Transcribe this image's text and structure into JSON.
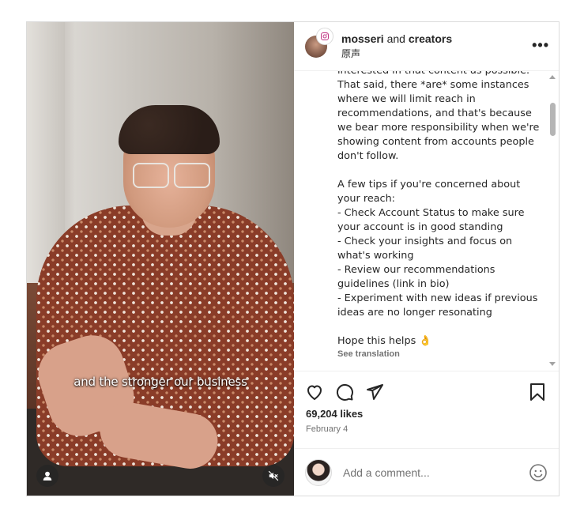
{
  "header": {
    "owner": "mosseri",
    "and": "and",
    "creators": "creators",
    "audio": "原声",
    "more_label": "•••"
  },
  "media": {
    "subtitle": "and the stronger our business",
    "user_icon": "user-icon",
    "mute_icon": "speaker-muted-icon"
  },
  "caption": {
    "text": "interested in that content as possible.\nThat said, there *are* some instances\nwhere we will limit reach in\nrecommendations, and that's because\nwe bear more responsibility when we're\nshowing content from accounts people\ndon't follow.\n\nA few tips if you're concerned about\nyour reach:\n- Check Account Status to make sure\nyour account is in good standing\n- Check your insights and focus on\nwhat's working\n- Review our recommendations\nguidelines (link in bio)\n- Experiment with new ideas if previous\nideas are no longer resonating\n\nHope this helps 👌",
    "see_translation": "See translation"
  },
  "actions": {
    "like_icon": "heart-icon",
    "comment_icon": "comment-bubble-icon",
    "share_icon": "paper-plane-icon",
    "save_icon": "bookmark-icon"
  },
  "likes": "69,204 likes",
  "date": "February 4",
  "comment": {
    "placeholder": "Add a comment...",
    "emoji_icon": "smiley-icon"
  },
  "colors": {
    "border": "#dbdbdb",
    "text": "#262626",
    "muted": "#737373"
  }
}
